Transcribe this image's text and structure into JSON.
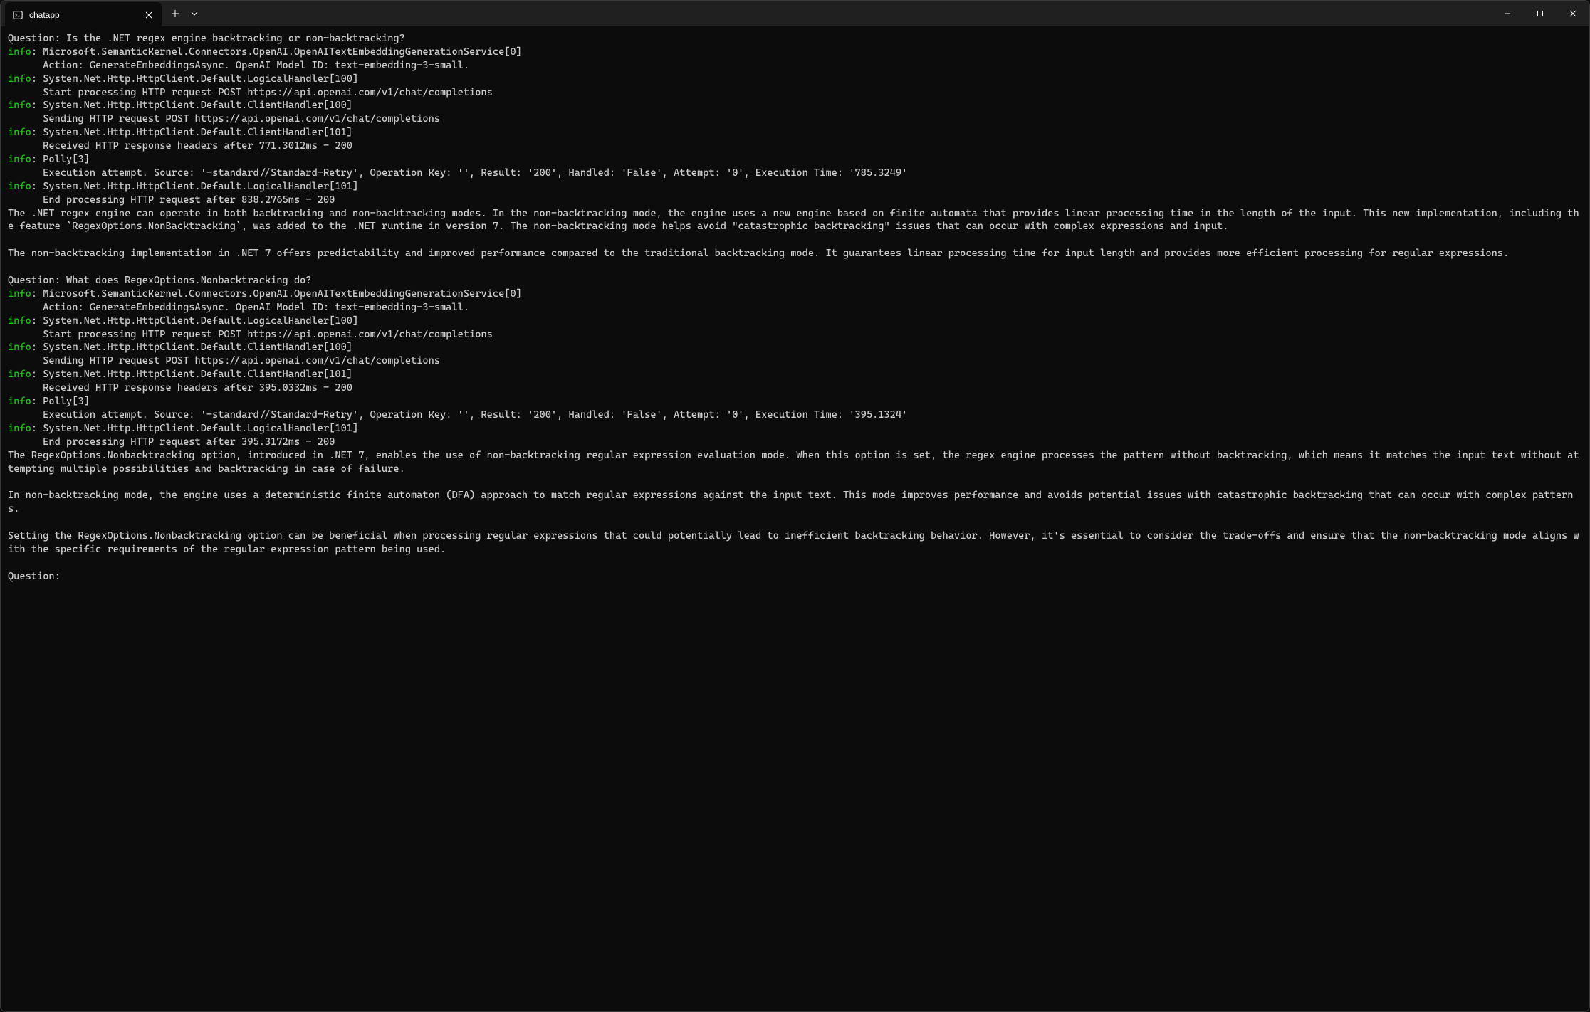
{
  "titlebar": {
    "tab_title": "chatapp"
  },
  "terminal": {
    "lines": [
      {
        "type": "plain",
        "text": "Question: Is the .NET regex engine backtracking or non-backtracking?"
      },
      {
        "type": "info",
        "text": "Microsoft.SemanticKernel.Connectors.OpenAI.OpenAITextEmbeddingGenerationService[0]"
      },
      {
        "type": "indent",
        "text": "      Action: GenerateEmbeddingsAsync. OpenAI Model ID: text-embedding-3-small."
      },
      {
        "type": "info",
        "text": "System.Net.Http.HttpClient.Default.LogicalHandler[100]"
      },
      {
        "type": "indent",
        "text": "      Start processing HTTP request POST https://api.openai.com/v1/chat/completions"
      },
      {
        "type": "info",
        "text": "System.Net.Http.HttpClient.Default.ClientHandler[100]"
      },
      {
        "type": "indent",
        "text": "      Sending HTTP request POST https://api.openai.com/v1/chat/completions"
      },
      {
        "type": "info",
        "text": "System.Net.Http.HttpClient.Default.ClientHandler[101]"
      },
      {
        "type": "indent",
        "text": "      Received HTTP response headers after 771.3012ms - 200"
      },
      {
        "type": "info",
        "text": "Polly[3]"
      },
      {
        "type": "indent",
        "text": "      Execution attempt. Source: '-standard//Standard-Retry', Operation Key: '', Result: '200', Handled: 'False', Attempt: '0', Execution Time: '785.3249'"
      },
      {
        "type": "info",
        "text": "System.Net.Http.HttpClient.Default.LogicalHandler[101]"
      },
      {
        "type": "indent",
        "text": "      End processing HTTP request after 838.2765ms - 200"
      },
      {
        "type": "answer",
        "text": "The .NET regex engine can operate in both backtracking and non-backtracking modes. In the non-backtracking mode, the engine uses a new engine based on finite automata that provides linear processing time in the length of the input. This new implementation, including the feature `RegexOptions.NonBacktracking`, was added to the .NET runtime in version 7. The non-backtracking mode helps avoid \"catastrophic backtracking\" issues that can occur with complex expressions and input."
      },
      {
        "type": "blank"
      },
      {
        "type": "answer",
        "text": "The non-backtracking implementation in .NET 7 offers predictability and improved performance compared to the traditional backtracking mode. It guarantees linear processing time for input length and provides more efficient processing for regular expressions."
      },
      {
        "type": "blank"
      },
      {
        "type": "plain",
        "text": "Question: What does RegexOptions.Nonbacktracking do?"
      },
      {
        "type": "info",
        "text": "Microsoft.SemanticKernel.Connectors.OpenAI.OpenAITextEmbeddingGenerationService[0]"
      },
      {
        "type": "indent",
        "text": "      Action: GenerateEmbeddingsAsync. OpenAI Model ID: text-embedding-3-small."
      },
      {
        "type": "info",
        "text": "System.Net.Http.HttpClient.Default.LogicalHandler[100]"
      },
      {
        "type": "indent",
        "text": "      Start processing HTTP request POST https://api.openai.com/v1/chat/completions"
      },
      {
        "type": "info",
        "text": "System.Net.Http.HttpClient.Default.ClientHandler[100]"
      },
      {
        "type": "indent",
        "text": "      Sending HTTP request POST https://api.openai.com/v1/chat/completions"
      },
      {
        "type": "info",
        "text": "System.Net.Http.HttpClient.Default.ClientHandler[101]"
      },
      {
        "type": "indent",
        "text": "      Received HTTP response headers after 395.0332ms - 200"
      },
      {
        "type": "info",
        "text": "Polly[3]"
      },
      {
        "type": "indent",
        "text": "      Execution attempt. Source: '-standard//Standard-Retry', Operation Key: '', Result: '200', Handled: 'False', Attempt: '0', Execution Time: '395.1324'"
      },
      {
        "type": "info",
        "text": "System.Net.Http.HttpClient.Default.LogicalHandler[101]"
      },
      {
        "type": "indent",
        "text": "      End processing HTTP request after 395.3172ms - 200"
      },
      {
        "type": "answer",
        "text": "The RegexOptions.Nonbacktracking option, introduced in .NET 7, enables the use of non-backtracking regular expression evaluation mode. When this option is set, the regex engine processes the pattern without backtracking, which means it matches the input text without attempting multiple possibilities and backtracking in case of failure."
      },
      {
        "type": "blank"
      },
      {
        "type": "answer",
        "text": "In non-backtracking mode, the engine uses a deterministic finite automaton (DFA) approach to match regular expressions against the input text. This mode improves performance and avoids potential issues with catastrophic backtracking that can occur with complex patterns."
      },
      {
        "type": "blank"
      },
      {
        "type": "answer",
        "text": "Setting the RegexOptions.Nonbacktracking option can be beneficial when processing regular expressions that could potentially lead to inefficient backtracking behavior. However, it's essential to consider the trade-offs and ensure that the non-backtracking mode aligns with the specific requirements of the regular expression pattern being used."
      },
      {
        "type": "blank"
      },
      {
        "type": "plain",
        "text": "Question: "
      }
    ]
  }
}
